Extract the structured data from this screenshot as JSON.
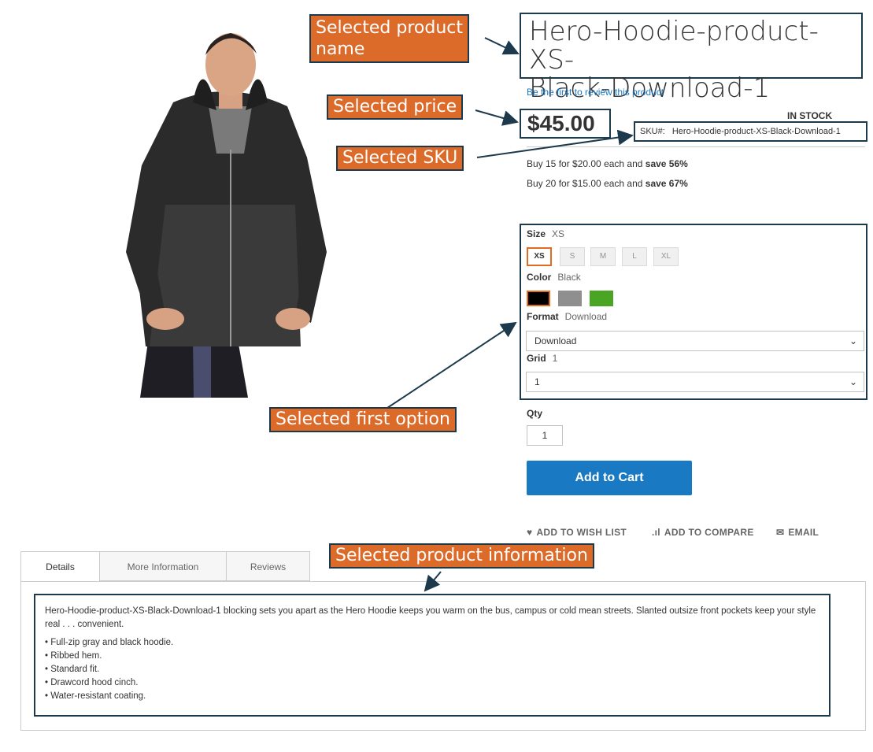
{
  "product": {
    "title": "Hero-Hoodie-product-XS-Black-Download-1",
    "title_line1": "Hero-Hoodie-product-XS-",
    "title_line2": "Black-Download-1",
    "review_link": "Be the first to review this product",
    "price": "$45.00",
    "stock": "IN STOCK",
    "sku_label": "SKU#:",
    "sku": "Hero-Hoodie-product-XS-Black-Download-1"
  },
  "tiers": [
    {
      "text": "Buy 15 for $20.00 each and ",
      "save": "save 56%"
    },
    {
      "text": "Buy 20 for $15.00 each and ",
      "save": "save 67%"
    }
  ],
  "options": {
    "size": {
      "label": "Size",
      "value": "XS",
      "choices": [
        "XS",
        "S",
        "M",
        "L",
        "XL"
      ],
      "selected": "XS"
    },
    "color": {
      "label": "Color",
      "value": "Black",
      "swatches": [
        "#000000",
        "#8f8f8f",
        "#4aa524"
      ],
      "selected": "#000000"
    },
    "format": {
      "label": "Format",
      "value": "Download",
      "select_value": "Download"
    },
    "grid": {
      "label": "Grid",
      "value": "1",
      "select_value": "1"
    }
  },
  "qty": {
    "label": "Qty",
    "value": "1"
  },
  "add_to_cart": "Add to Cart",
  "actions": [
    {
      "icon": "heart-icon",
      "glyph": "♥",
      "label": "ADD TO WISH LIST"
    },
    {
      "icon": "bar-chart-icon",
      "glyph": ".ıl",
      "label": "ADD TO COMPARE"
    },
    {
      "icon": "envelope-icon",
      "glyph": "✉",
      "label": "EMAIL"
    }
  ],
  "tabs": [
    "Details",
    "More Information",
    "Reviews"
  ],
  "details": {
    "paragraph": "Hero-Hoodie-product-XS-Black-Download-1 blocking sets you apart as the Hero Hoodie keeps you warm on the bus, campus or cold mean streets. Slanted outsize front pockets keep your style real . . . convenient.",
    "bullets": [
      "Full-zip gray and black hoodie.",
      "Ribbed hem.",
      "Standard fit.",
      "Drawcord hood cinch.",
      "Water-resistant coating."
    ]
  },
  "callouts": {
    "name_line1": "Selected product",
    "name_line2": "name",
    "price": "Selected price",
    "sku": "Selected SKU",
    "option": "Selected first option",
    "info": "Selected product information"
  },
  "colors": {
    "accent": "#1979c3",
    "callout": "#dc6a29",
    "callout_border": "#1d3a4c",
    "selected_swatch": "#e16b20"
  }
}
